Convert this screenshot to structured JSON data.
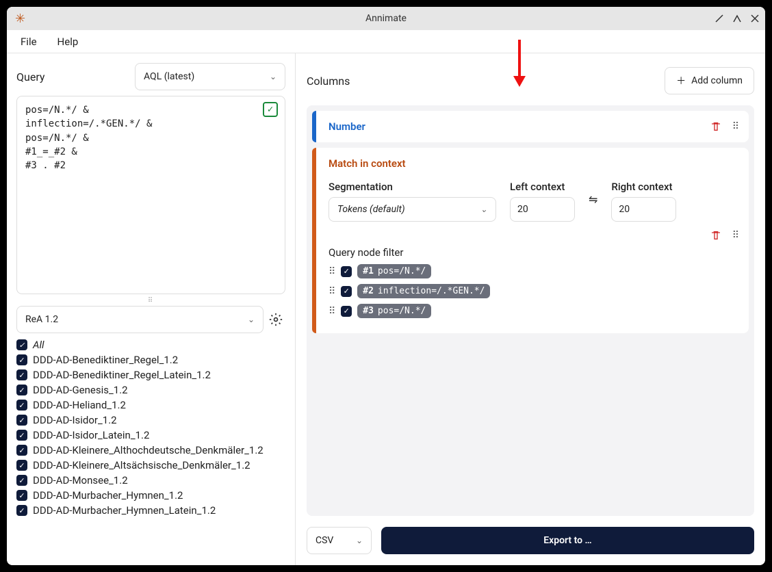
{
  "window": {
    "title": "Annimate"
  },
  "menu": {
    "file": "File",
    "help": "Help"
  },
  "query": {
    "label": "Query",
    "lang": "AQL (latest)",
    "text": "pos=/N.*/ &\ninflection=/.*GEN.*/ &\npos=/N.*/ &\n#1_=_#2 &\n#3 . #2"
  },
  "corpus": {
    "selected": "ReA 1.2",
    "all_label": "All",
    "items": [
      "DDD-AD-Benediktiner_Regel_1.2",
      "DDD-AD-Benediktiner_Regel_Latein_1.2",
      "DDD-AD-Genesis_1.2",
      "DDD-AD-Heliand_1.2",
      "DDD-AD-Isidor_1.2",
      "DDD-AD-Isidor_Latein_1.2",
      "DDD-AD-Kleinere_Althochdeutsche_Denkmäler_1.2",
      "DDD-AD-Kleinere_Altsächsische_Denkmäler_1.2",
      "DDD-AD-Monsee_1.2",
      "DDD-AD-Murbacher_Hymnen_1.2",
      "DDD-AD-Murbacher_Hymnen_Latein_1.2"
    ]
  },
  "columns": {
    "label": "Columns",
    "add": "Add column",
    "number": {
      "title": "Number"
    },
    "match": {
      "title": "Match in context",
      "segmentation_label": "Segmentation",
      "segmentation_value": "Tokens (default)",
      "left_label": "Left context",
      "left_value": "20",
      "right_label": "Right context",
      "right_value": "20",
      "qnf_label": "Query node filter",
      "qnf": [
        {
          "idx": "#1",
          "expr": "pos=/N.*/"
        },
        {
          "idx": "#2",
          "expr": "inflection=/.*GEN.*/"
        },
        {
          "idx": "#3",
          "expr": "pos=/N.*/"
        }
      ]
    }
  },
  "export": {
    "format": "CSV",
    "button": "Export to …"
  }
}
